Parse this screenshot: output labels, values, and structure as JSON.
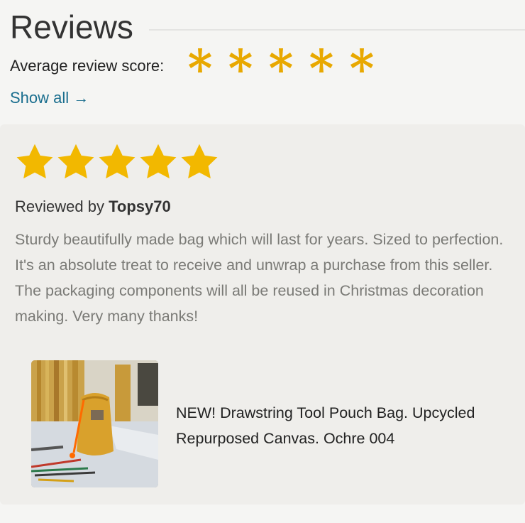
{
  "header": {
    "title": "Reviews"
  },
  "average": {
    "label": "Average review score:",
    "score": 5,
    "max": 5,
    "star_color": "#e8a800"
  },
  "show_all": {
    "label": "Show all →",
    "color": "#1a6e8e"
  },
  "review": {
    "rating": 5,
    "star_color": "#f2b800",
    "reviewed_by_prefix": "Reviewed by",
    "reviewer": "Topsy70",
    "text": "Sturdy beautifully made bag which will last for years. Sized to perfection. It's an absolute treat to receive and unwrap a purchase from this seller. The packaging components will all be reused in Christmas decoration making. Very many thanks!",
    "product": {
      "title": "NEW! Drawstring Tool Pouch Bag. Upcycled Repurposed Canvas. Ochre 004",
      "image_icon": "product-photo"
    }
  }
}
